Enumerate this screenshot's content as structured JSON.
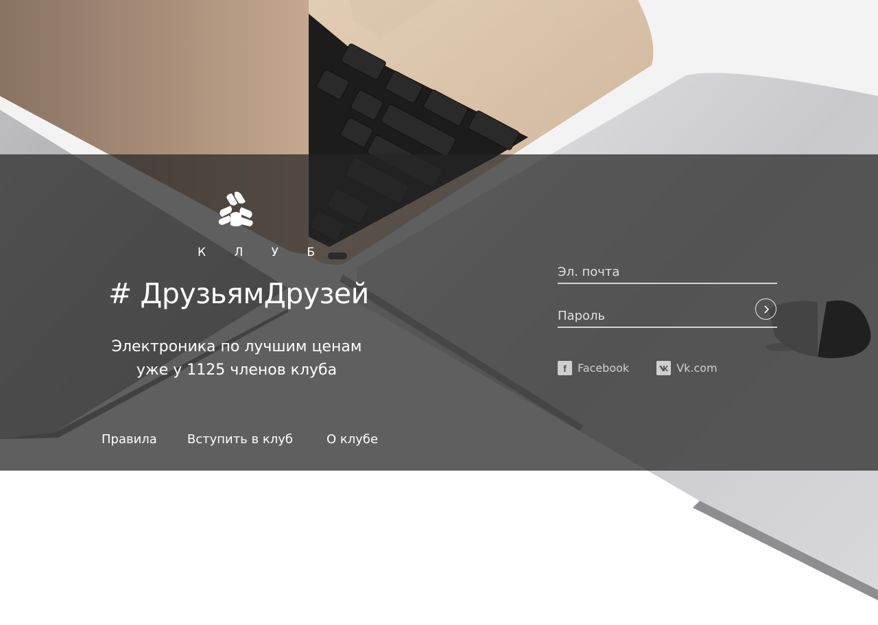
{
  "club": {
    "label": "К Л У Б",
    "hashtag": "# ДрузьямДрузей",
    "tagline_line1": "Электроника по лучшим ценам",
    "tagline_line2": "уже у 1125 членов клуба"
  },
  "nav": {
    "rules": "Правила",
    "join": "Вступить в клуб",
    "about": "О клубе"
  },
  "login": {
    "email_placeholder": "Эл. почта",
    "password_placeholder": "Пароль"
  },
  "social": {
    "facebook": "Facebook",
    "vk": "Vk.com"
  },
  "icons": {
    "logo": "club-logo-icon",
    "submit": "arrow-right-circle-icon",
    "facebook": "facebook-icon",
    "vk": "vk-icon"
  },
  "colors": {
    "band": "#262626",
    "text": "#ffffff"
  }
}
